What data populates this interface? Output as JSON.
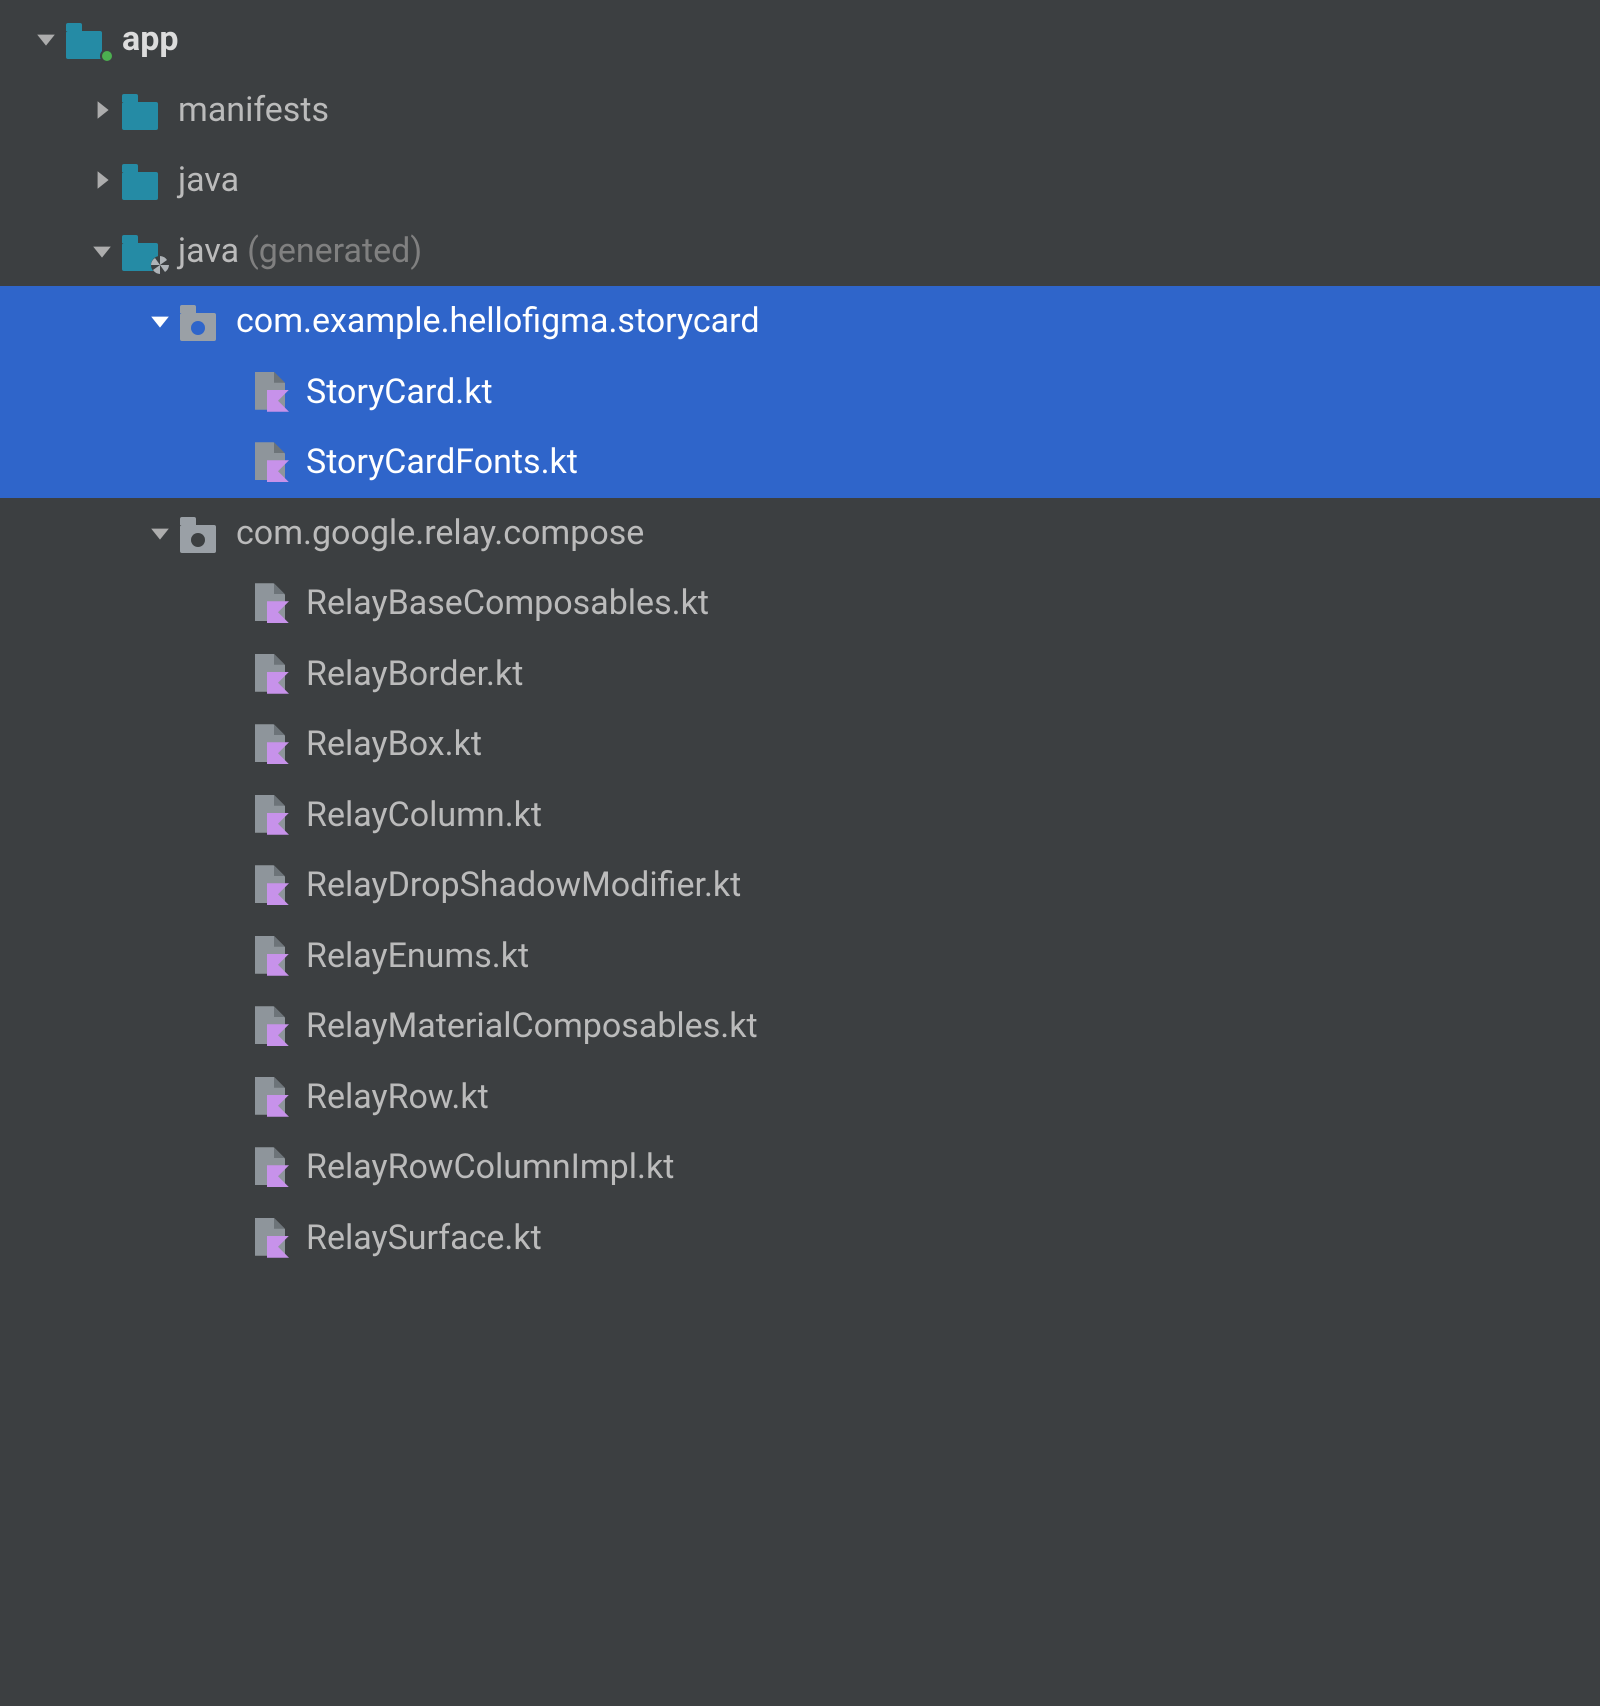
{
  "tree": {
    "app": {
      "label": "app"
    },
    "manifests": {
      "label": "manifests"
    },
    "java": {
      "label": "java"
    },
    "java_gen": {
      "label": "java",
      "suffix": "(generated)"
    },
    "pkg_storycard": {
      "label": "com.example.hellofigma.storycard"
    },
    "file_storycard": {
      "label": "StoryCard.kt"
    },
    "file_storycardfonts": {
      "label": "StoryCardFonts.kt"
    },
    "pkg_relay": {
      "label": "com.google.relay.compose"
    },
    "file_relaybase": {
      "label": "RelayBaseComposables.kt"
    },
    "file_relayborder": {
      "label": "RelayBorder.kt"
    },
    "file_relaybox": {
      "label": "RelayBox.kt"
    },
    "file_relaycolumn": {
      "label": "RelayColumn.kt"
    },
    "file_relaydrop": {
      "label": "RelayDropShadowModifier.kt"
    },
    "file_relayenums": {
      "label": "RelayEnums.kt"
    },
    "file_relaymaterial": {
      "label": "RelayMaterialComposables.kt"
    },
    "file_relayrow": {
      "label": "RelayRow.kt"
    },
    "file_relayrowcol": {
      "label": "RelayRowColumnImpl.kt"
    },
    "file_relaysurface": {
      "label": "RelaySurface.kt"
    }
  }
}
